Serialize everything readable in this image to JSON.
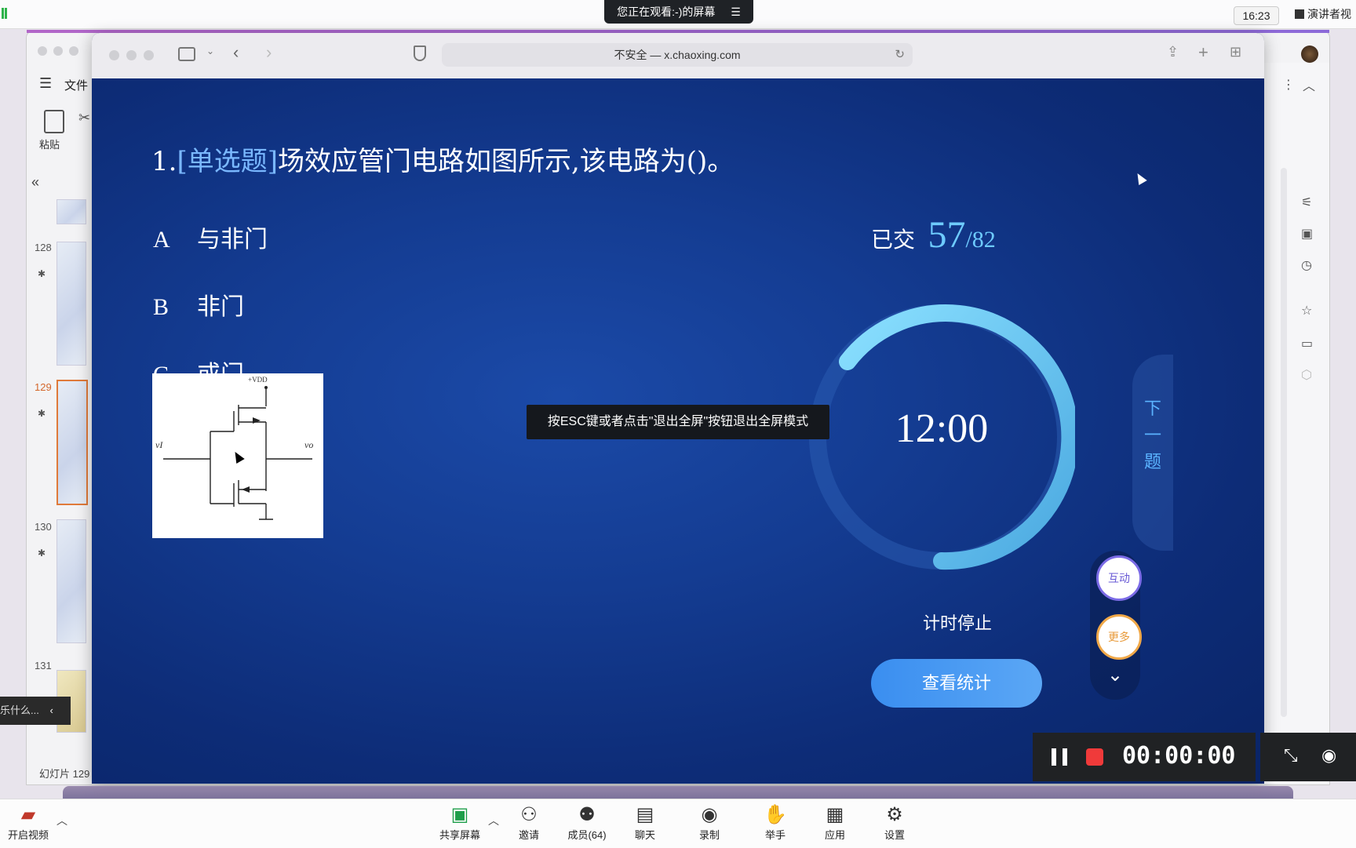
{
  "system_bar": {
    "share_banner": "您正在观看:-)的屏幕",
    "clock": "16:23",
    "speaker_view": "演讲者视"
  },
  "ppt": {
    "menu_file": "文件",
    "paste_label": "粘贴",
    "slide_numbers": [
      "128",
      "129",
      "130",
      "131"
    ],
    "footer": "幻灯片 129",
    "left_chip": "乐什么..."
  },
  "browser": {
    "url": "不安全 — x.chaoxing.com"
  },
  "quiz": {
    "question_number": "1.",
    "question_type": "[单选题]",
    "question_text": "场效应管门电路如图所示,该电路为()。",
    "options": [
      {
        "letter": "A",
        "text": "与非门"
      },
      {
        "letter": "B",
        "text": "非门"
      },
      {
        "letter": "C",
        "text": "或门"
      }
    ],
    "circuit_labels": {
      "vdd": "+VDD",
      "vi": "vI",
      "vo": "vo"
    },
    "submitted_label": "已交",
    "submitted_count": "57",
    "total_count": "/82",
    "timer": "12:00",
    "timer_status": "计时停止",
    "stats_button": "查看统计",
    "next_question": [
      "下",
      "一",
      "题"
    ],
    "interact_button": "互动",
    "more_button": "更多",
    "back_button": "返回",
    "fullscreen_button": "全屏",
    "toast": "按ESC键或者点击\"退出全屏\"按钮退出全屏模式"
  },
  "recording": {
    "elapsed": "00:00:00"
  },
  "zoom_toolbar": {
    "video": "开启视频",
    "share": "共享屏幕",
    "invite": "邀请",
    "members": "成员(64)",
    "chat": "聊天",
    "record": "录制",
    "raise_hand": "举手",
    "apps": "应用",
    "settings": "设置"
  }
}
